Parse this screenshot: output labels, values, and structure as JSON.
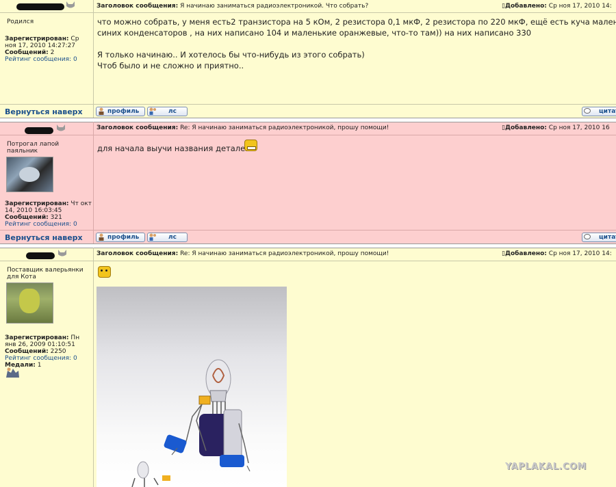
{
  "post1": {
    "header_label": "Заголовок сообщения:",
    "title": "Я начинаю заниматься радиоэлектроникой. Что собрать?",
    "added_label": "Добавлено:",
    "date": "Ср ноя 17, 2010 14:",
    "user_title": "Родился",
    "registered_label": "Зарегистрирован:",
    "registered": "Ср ноя 17, 2010 14:27:27",
    "messages_label": "Сообщений:",
    "messages": "2",
    "rating_label": "Рейтинг сообщения:",
    "rating": "0",
    "body": [
      "что можно собрать, у меня есть2 транзистора на 5 кОм, 2 резистора 0,1 мкФ, 2 резистора по 220 мкФ, ещё есть куча маленьких",
      "синих конденсаторов , на них написано 104 и маленькие оранжевые, что-то там)) на них написано 330",
      "",
      "Я только начинаю.. И хотелось бы что-нибудь из этого собрать)",
      "Чтоб было и не сложно и приятно.."
    ]
  },
  "post2": {
    "header_label": "Заголовок сообщения:",
    "title": "Re: Я начинаю заниматься радиоэлектроникой, прошу помощи!",
    "added_label": "Добавлено:",
    "date": "Ср ноя 17, 2010 16",
    "user_title": "Потрогал лапой паяльник",
    "registered_label": "Зарегистрирован:",
    "registered": "Чт окт 14, 2010 16:03:45",
    "messages_label": "Сообщений:",
    "messages": "321",
    "rating_label": "Рейтинг сообщения:",
    "rating": "0",
    "body": "для начала выучи названия деталей"
  },
  "post3": {
    "header_label": "Заголовок сообщения:",
    "title": "Re: Я начинаю заниматься радиоэлектроникой, прошу помощи!",
    "added_label": "Добавлено:",
    "date": "Ср ноя 17, 2010 14:",
    "user_title": "Поставщик валерьянки для Кота",
    "registered_label": "Зарегистрирован:",
    "registered": "Пн янв 26, 2009 01:10:51",
    "messages_label": "Сообщений:",
    "messages": "2250",
    "rating_label": "Рейтинг сообщения:",
    "rating": "0",
    "medals_label": "Медали:",
    "medals": "1"
  },
  "bar": {
    "back_to_top": "Вернуться наверх",
    "profile": "профиль",
    "pm": "лс",
    "quote": "цитата"
  },
  "watermark": "YAPLAKAL.COM",
  "colors": {
    "post_yellow": "#fefcd0",
    "post_pink": "#fdcfcf",
    "link_blue": "#1a4f8c"
  }
}
